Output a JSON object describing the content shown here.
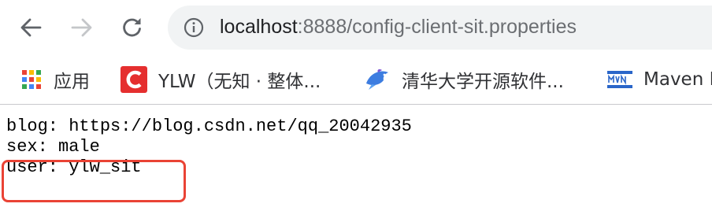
{
  "browser": {
    "url": {
      "host": "localhost",
      "rest": ":8888/config-client-sit.properties"
    },
    "bookmarks": [
      {
        "label": "应用",
        "icon": "apps-grid-icon"
      },
      {
        "label": "YLW（无知 · 整体...",
        "icon": "csdn-c-icon"
      },
      {
        "label": "清华大学开源软件...",
        "icon": "tuna-fish-icon"
      },
      {
        "label": "Maven R",
        "icon": "mvn-icon"
      }
    ]
  },
  "page": {
    "lines": [
      "blog: https://blog.csdn.net/qq_20042935",
      "sex: male",
      "user: ylw_sit"
    ]
  },
  "colors": {
    "highlight": "#ea4335",
    "omnibox_bg": "#f1f3f4",
    "csdn_red": "#e52f2f"
  }
}
